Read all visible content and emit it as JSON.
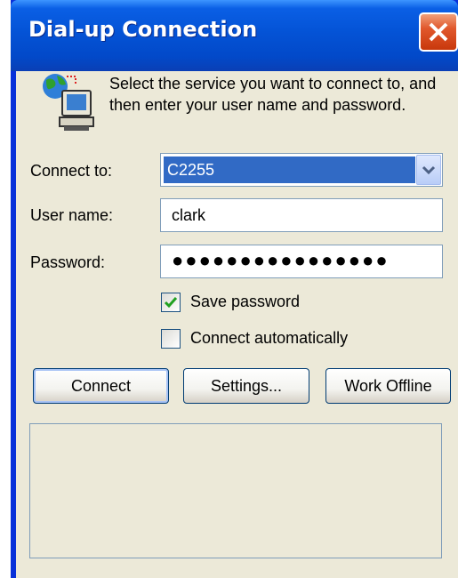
{
  "window": {
    "title": "Dial-up Connection",
    "close_icon": "close-x-icon",
    "connection_icon": "globe-computer-icon"
  },
  "intro_text": "Select the service you want to connect to, and then enter your user name and password.",
  "form": {
    "connect_to": {
      "label": "Connect to:",
      "value": "C2255"
    },
    "user_name": {
      "label": "User name:",
      "value": "clark"
    },
    "password": {
      "label": "Password:",
      "value": "●●●●●●●●●●●●●●●●"
    },
    "save_password": {
      "label": "Save password",
      "checked": true
    },
    "connect_automatically": {
      "label": "Connect automatically",
      "checked": false
    }
  },
  "buttons": {
    "connect": "Connect",
    "settings": "Settings...",
    "work_offline": "Work Offline"
  },
  "colors": {
    "titlebar": "#0453d6",
    "close": "#e1582c",
    "selection": "#316ac5",
    "dialog_bg": "#ece9d8",
    "check_mark": "#21a121"
  }
}
